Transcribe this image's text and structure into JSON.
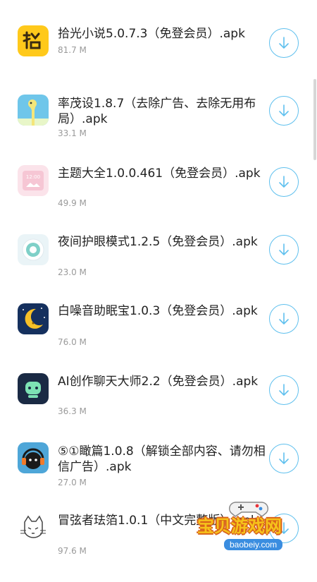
{
  "items": [
    {
      "title": "拾光小说5.0.7.3（免登会员）.apk",
      "size": "81.7 M",
      "icon": "shiguang-logo-icon"
    },
    {
      "title": "率茂设1.8.7（去除广告、去除无用布局）.apk",
      "size": "33.1 M",
      "icon": "giraffe-app-icon"
    },
    {
      "title": "主题大全1.0.0.461（免登会员）.apk",
      "size": "49.9 M",
      "icon": "theme-app-icon"
    },
    {
      "title": "夜间护眼模式1.2.5（免登会员）.apk",
      "size": "23.0 M",
      "icon": "eye-care-app-icon"
    },
    {
      "title": "白噪音助眠宝1.0.3（免登会员）.apk",
      "size": "76.0 M",
      "icon": "moon-sleep-app-icon"
    },
    {
      "title": "AI创作聊天大师2.2（免登会员）.apk",
      "size": "36.3 M",
      "icon": "ai-robot-app-icon"
    },
    {
      "title": "⑤①瞰篇1.0.8（解锁全部内容、请勿相信广告）.apk",
      "size": "27.0 M",
      "icon": "headphone-cat-app-icon"
    },
    {
      "title": "冒弦者珐箔1.0.1（中文完整版）.apk",
      "size": "97.6 M",
      "icon": "cat-sketch-app-icon"
    }
  ],
  "watermark": {
    "text": "宝贝游戏网",
    "url": "baobeiy.com"
  },
  "colors": {
    "accent": "#5fc0ee",
    "size_text": "#9a9a9a",
    "title_text": "#222222"
  }
}
